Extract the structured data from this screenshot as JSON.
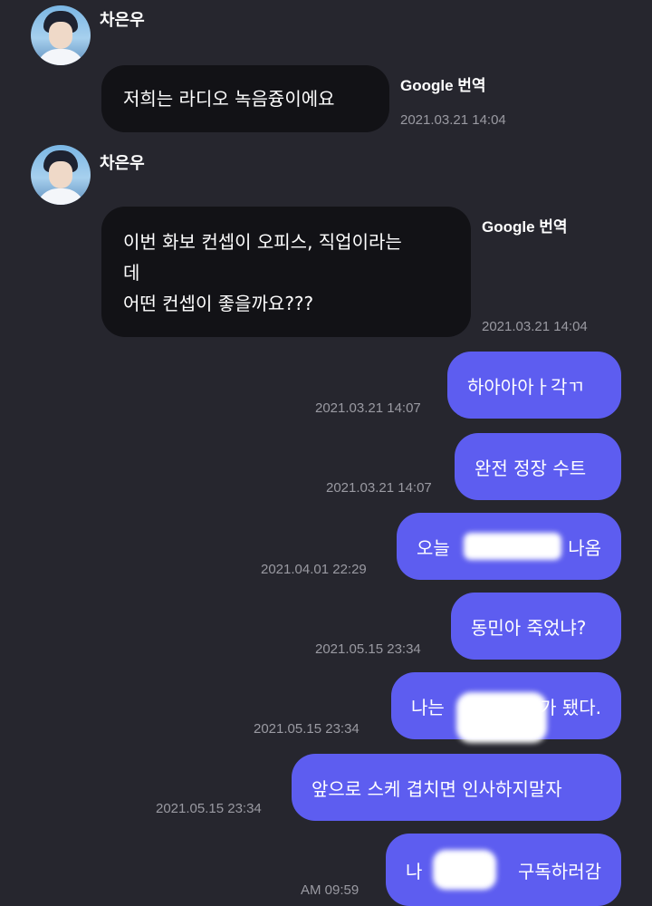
{
  "sender": {
    "name": "차은우"
  },
  "incoming": [
    {
      "text_lines": [
        "저희는 라디오 녹음즁이에요"
      ],
      "translate_label": "Google 번역",
      "time": "2021.03.21 14:04"
    },
    {
      "text_lines": [
        "이번 화보 컨셉이 오피스, 직업이라는",
        "데",
        "어떤 컨셉이 좋을까요???"
      ],
      "translate_label": "Google 번역",
      "time": "2021.03.21 14:04"
    }
  ],
  "outgoing": [
    {
      "text": "하아아아ㅏ각ㄲ",
      "time": "2021.03.21 14:07"
    },
    {
      "text": "완전 정장 수트",
      "time": "2021.03.21 14:07"
    },
    {
      "text_left": "오늘",
      "text_right": "나옴",
      "time": "2021.04.01 22:29"
    },
    {
      "text": "동민아 죽었냐?",
      "time": "2021.05.15 23:34"
    },
    {
      "text_left": "나는",
      "text_right": "'가 됐다.",
      "time": "2021.05.15 23:34"
    },
    {
      "text": "앞으로 스케 겹치면 인사하지말자",
      "time": "2021.05.15 23:34"
    },
    {
      "text_left": "나",
      "text_right": "구독하러감",
      "time": "AM 09:59"
    }
  ]
}
